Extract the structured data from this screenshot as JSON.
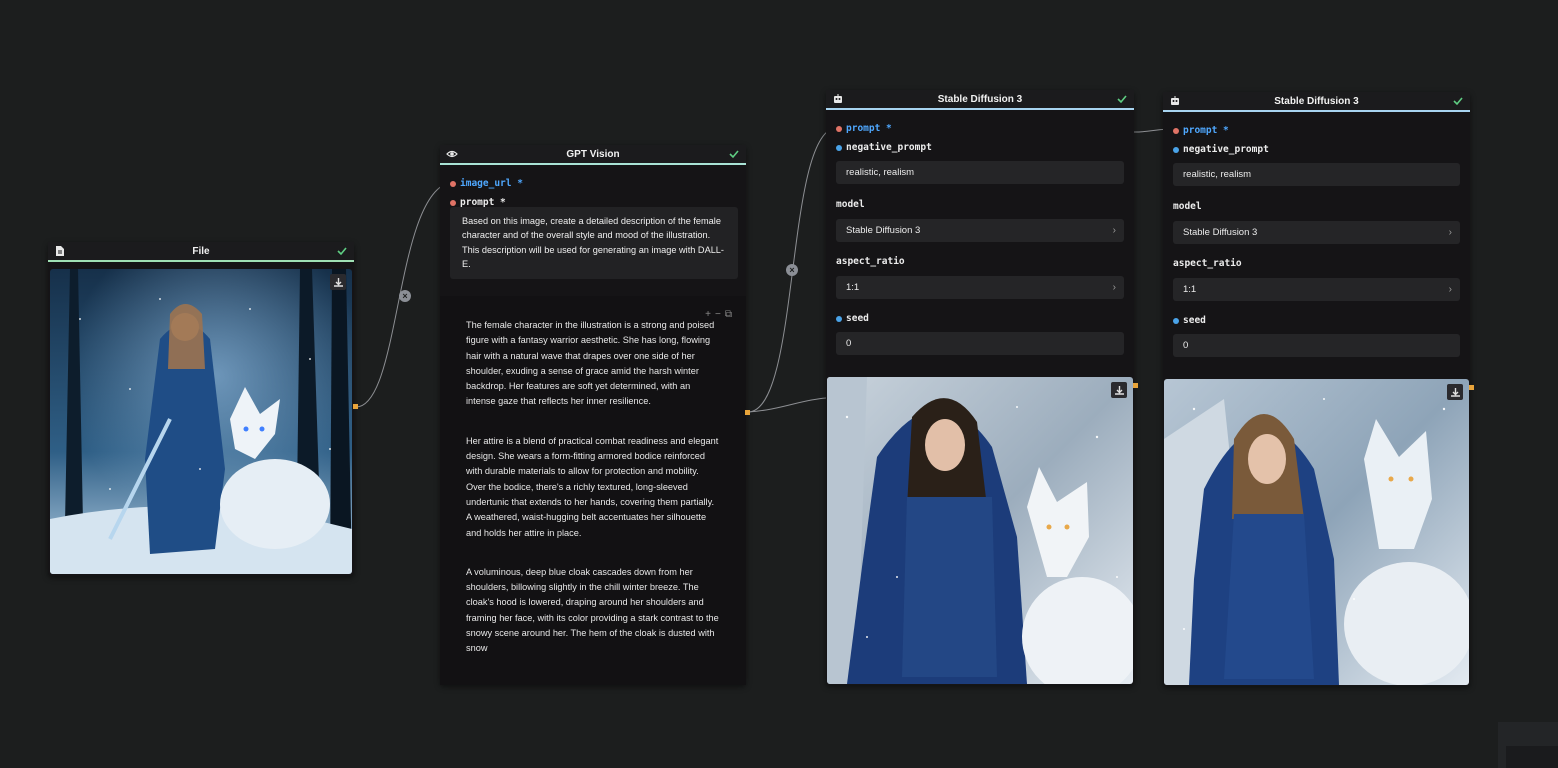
{
  "nodes": {
    "file": {
      "title": "File"
    },
    "gpt": {
      "title": "GPT Vision",
      "param_image_url": "image_url *",
      "param_prompt": "prompt *",
      "prompt_text": "Based on this image, create a detailed description of the female character and of the overall style and mood of the illustration. This description will be used for generating an image with DALL-E.",
      "output_paragraphs": [
        "The female character in the illustration is a strong and poised figure with a fantasy warrior aesthetic. She has long, flowing hair with a natural wave that drapes over one side of her shoulder, exuding a sense of grace amid the harsh winter backdrop. Her features are soft yet determined, with an intense gaze that reflects her inner resilience.",
        "Her attire is a blend of practical combat readiness and elegant design. She wears a form-fitting armored bodice reinforced with durable materials to allow for protection and mobility. Over the bodice, there's a richly textured, long-sleeved undertunic that extends to her hands, covering them partially. A weathered, waist-hugging belt accentuates her silhouette and holds her attire in place.",
        "A voluminous, deep blue cloak cascades down from her shoulders, billowing slightly in the chill winter breeze. The cloak's hood is lowered, draping around her shoulders and framing her face, with its color providing a stark contrast to the snowy scene around her. The hem of the cloak is dusted with snow"
      ]
    },
    "sd1": {
      "title": "Stable Diffusion 3",
      "param_prompt": "prompt *",
      "param_negative": "negative_prompt",
      "negative_value": "realistic, realism",
      "label_model": "model",
      "model_value": "Stable Diffusion 3",
      "label_aspect": "aspect_ratio",
      "aspect_value": "1:1",
      "param_seed": "seed",
      "seed_value": "0"
    },
    "sd2": {
      "title": "Stable Diffusion 3",
      "param_prompt": "prompt *",
      "param_negative": "negative_prompt",
      "negative_value": "realistic, realism",
      "label_model": "model",
      "model_value": "Stable Diffusion 3",
      "label_aspect": "aspect_ratio",
      "aspect_value": "1:1",
      "param_seed": "seed",
      "seed_value": "0"
    }
  },
  "icons": {
    "file_header": "document-icon",
    "gpt_header": "eye-icon",
    "sd_header": "robot-icon",
    "status": "check-icon",
    "download": "download-icon",
    "edge_remove": "close-icon",
    "text_tools": [
      "plus-icon",
      "minus-icon",
      "copy-icon"
    ]
  },
  "colors": {
    "background": "#1c1e1e",
    "node": "#151416",
    "file_bar": "#9fe0b4",
    "gpt_bar": "#a9e3d6",
    "sd_bar": "#a8d4f0",
    "check": "#5fce83",
    "port": "#e8a43a",
    "link_param": "#4fa8ff"
  }
}
